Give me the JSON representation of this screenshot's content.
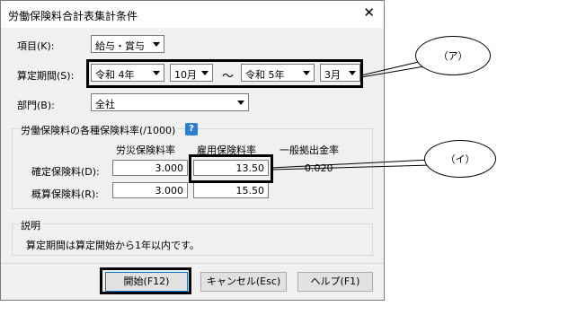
{
  "dialog": {
    "title": "労働保険料合計表集計条件",
    "close": "✕"
  },
  "fields": {
    "item_label": "項目(K):",
    "item_value": "給与・賞与",
    "period_label": "算定期間(S):",
    "from_year": "令和 4年",
    "from_month": "10月",
    "tilde": "～",
    "to_year": "令和 5年",
    "to_month": "3月",
    "dept_label": "部門(B):",
    "dept_value": "全社"
  },
  "rates": {
    "group_label": "労働保険料の各種保険料率(/1000)",
    "help": "?",
    "col_labor": "労災保険料率",
    "col_employ": "雇用保険料率",
    "col_general": "一般拠出金率",
    "row_fixed_label": "確定保険料(D):",
    "row_est_label": "概算保険料(R):",
    "fixed_labor": "3.000",
    "fixed_employ": "13.50",
    "fixed_general": "0.020",
    "est_labor": "3.000",
    "est_employ": "15.50"
  },
  "description": {
    "group_label": "説明",
    "text": "算定期間は算定開始から1年以内です。"
  },
  "buttons": {
    "start": "開始(F12)",
    "cancel": "キャンセル(Esc)",
    "help": "ヘルプ(F1)"
  },
  "callouts": {
    "a": "（ア）",
    "i": "（イ）"
  }
}
